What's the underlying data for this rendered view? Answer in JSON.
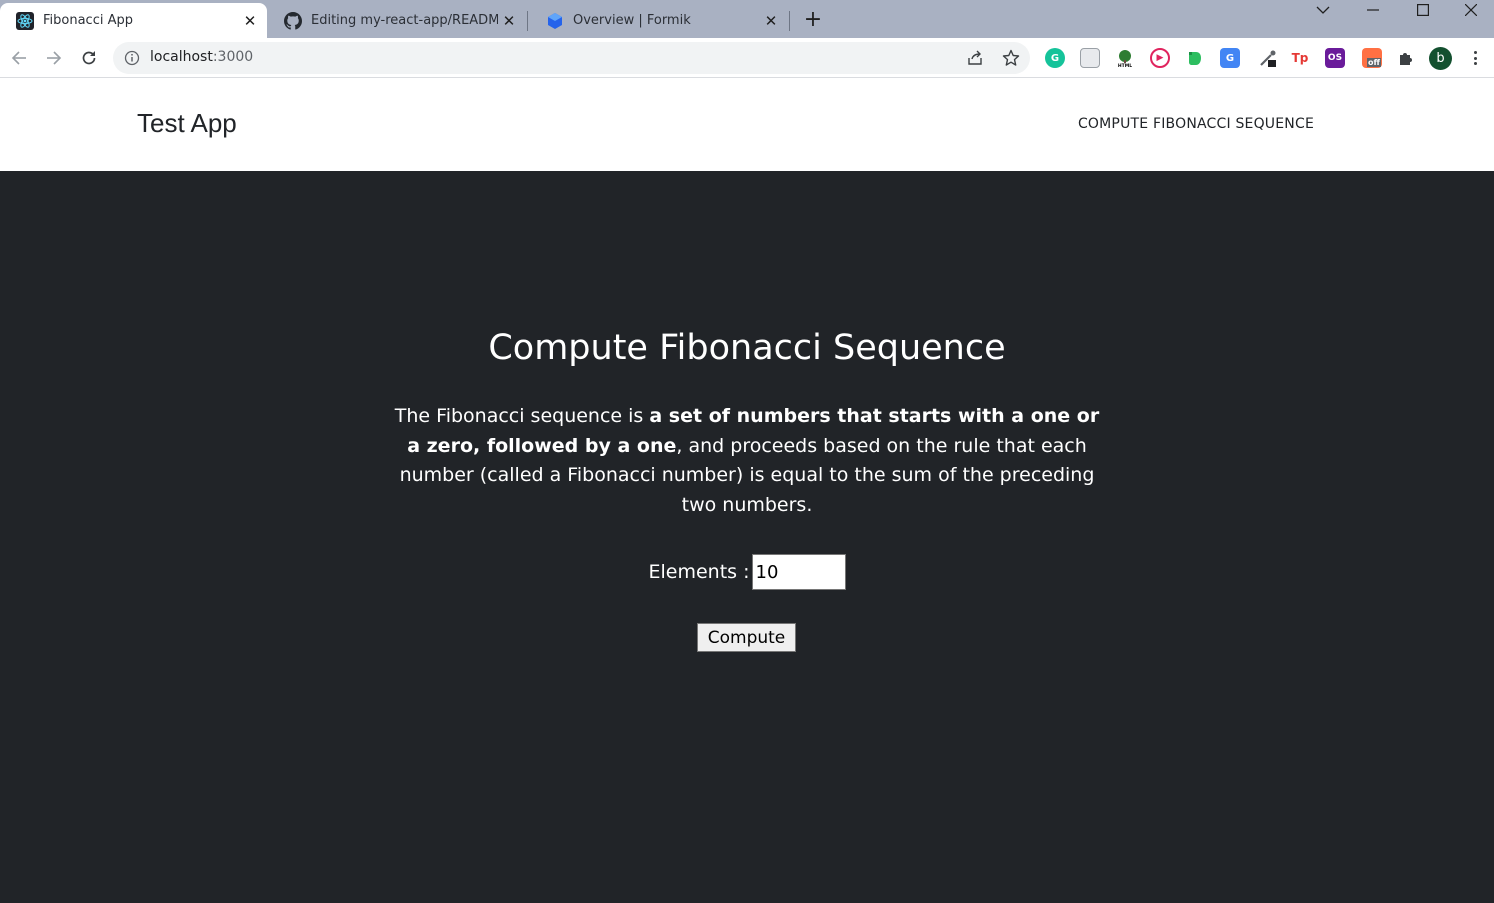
{
  "browser": {
    "tabs": [
      {
        "title": "Fibonacci App",
        "icon": "react-icon",
        "active": true
      },
      {
        "title": "Editing my-react-app/README.md",
        "icon": "github-icon",
        "active": false
      },
      {
        "title": "Overview | Formik",
        "icon": "formik-icon",
        "active": false
      }
    ],
    "url_host": "localhost",
    "url_port": ":3000",
    "profile_initial": "b",
    "extensions": [
      {
        "name": "grammarly-icon",
        "label": "G",
        "color": "#15c39a"
      },
      {
        "name": "page-icon",
        "label": "",
        "color": "#e8eaed"
      },
      {
        "name": "html-tree-icon",
        "label": "",
        "color": "#2e7d32"
      },
      {
        "name": "play-icon",
        "label": "▶",
        "color": "#e0245e"
      },
      {
        "name": "evernote-icon",
        "label": "",
        "color": "#2dbe60"
      },
      {
        "name": "translate-icon",
        "label": "G",
        "color": "#4285f4"
      },
      {
        "name": "eyedropper-icon",
        "label": "",
        "color": "#5f6368"
      },
      {
        "name": "tp-icon",
        "label": "Tp",
        "color": "#e53935"
      },
      {
        "name": "os-icon",
        "label": "OS",
        "color": "#6a1b9a"
      },
      {
        "name": "off-icon",
        "label": "off",
        "color": "#ff7043"
      },
      {
        "name": "puzzle-icon",
        "label": "",
        "color": "#3c4043"
      }
    ]
  },
  "header": {
    "brand": "Test App",
    "nav_link": "COMPUTE FIBONACCI SEQUENCE"
  },
  "main": {
    "heading": "Compute Fibonacci Sequence",
    "desc_part1": "The Fibonacci sequence is ",
    "desc_bold": "a set of numbers that starts with a one or a zero, followed by a one",
    "desc_part2": ", and proceeds based on the rule that each number (called a Fibonacci number) is equal to the sum of the preceding two numbers.",
    "elements_label": "Elements :",
    "elements_value": "10",
    "compute_label": "Compute"
  },
  "colors": {
    "background": "#212428",
    "header_bg": "#ffffff",
    "tabstrip": "#a9b1c2"
  }
}
